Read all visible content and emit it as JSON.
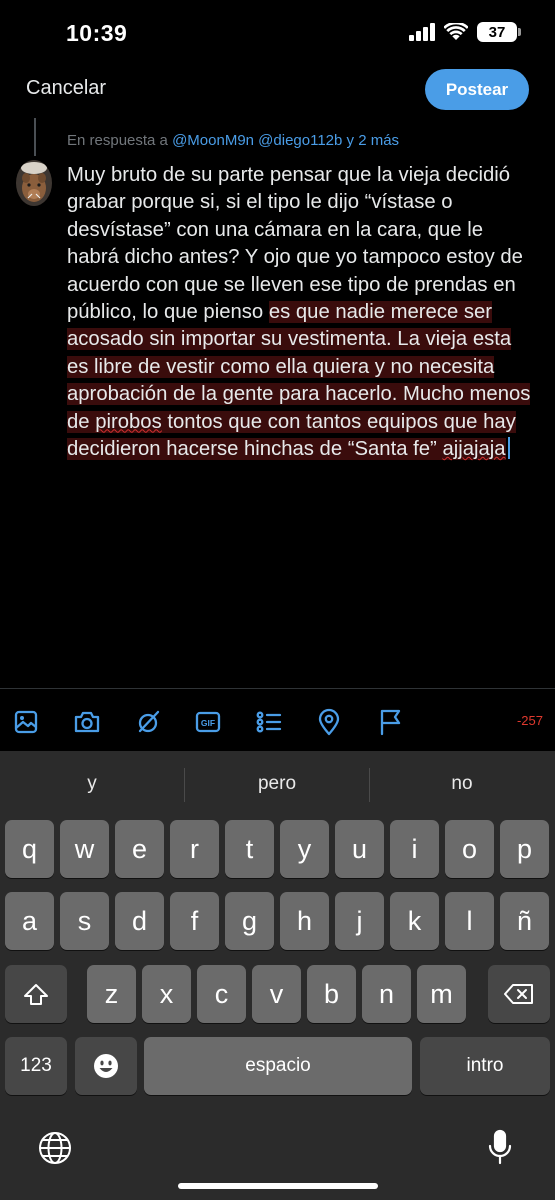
{
  "status": {
    "time": "10:39",
    "battery": "37"
  },
  "header": {
    "cancel_label": "Cancelar",
    "post_label": "Postear"
  },
  "reply": {
    "prefix": "En respuesta a",
    "mentions": "@MoonM9n @diego112b",
    "suffix": "y 2 más"
  },
  "compose": {
    "text_normal": "Muy bruto de su parte pensar que la vieja decidió grabar porque si, si el tipo le dijo “vístase o desvístase” con una cámara en la cara, que le habrá dicho antes? Y ojo que yo tampoco estoy de acuerdo con que se lleven ese tipo de prendas en público, lo que pienso",
    "text_over_1": "es que nadie merece ser acosado sin importar su vestimenta. La vieja esta es libre de vestir como ella quiera y no necesita aprobación de la gente para hacerlo. Mucho menos de ",
    "misspelled_1": "pirobos",
    "text_over_2": " tontos que con tantos equipos que hay decidieron hacerse hinchas de “Santa fe” ",
    "misspelled_2": "ajjajaja"
  },
  "toolbar": {
    "icons": [
      "image-icon",
      "camera-icon",
      "grok-icon",
      "gif-icon",
      "poll-icon",
      "location-icon",
      "flag-icon"
    ],
    "gif_label": "GIF",
    "char_count": "-257",
    "accent": "#4a9de7",
    "over_limit_color": "#e0392e"
  },
  "keyboard": {
    "suggestions": [
      "y",
      "pero",
      "no"
    ],
    "row1": [
      "q",
      "w",
      "e",
      "r",
      "t",
      "y",
      "u",
      "i",
      "o",
      "p"
    ],
    "row2": [
      "a",
      "s",
      "d",
      "f",
      "g",
      "h",
      "j",
      "k",
      "l",
      "ñ"
    ],
    "row3": [
      "z",
      "x",
      "c",
      "v",
      "b",
      "n",
      "m"
    ],
    "numbers_label": "123",
    "space_label": "espacio",
    "return_label": "intro"
  }
}
